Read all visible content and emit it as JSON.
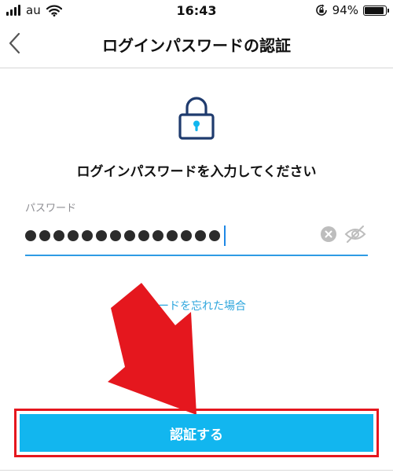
{
  "status_bar": {
    "carrier": "au",
    "time": "16:43",
    "battery_percent": "94%",
    "battery_level": 0.94
  },
  "nav": {
    "title": "ログインパスワードの認証"
  },
  "content": {
    "prompt": "ログインパスワードを入力してください",
    "password_label": "パスワード",
    "password_masked_length": 14,
    "forgot_link": "ワードを忘れた場合"
  },
  "auth_button": {
    "label": "認証する"
  },
  "icons": {
    "back": "chevron-left-icon",
    "lock": "lock-icon",
    "clear": "clear-icon",
    "visibility": "eye-off-icon",
    "signal": "signal-icon",
    "wifi": "wifi-icon",
    "rotation_lock": "rotation-lock-icon",
    "battery": "battery-icon"
  },
  "colors": {
    "accent": "#12b6ef",
    "link": "#2ea6dd",
    "icon_navy": "#1f3b6e",
    "highlight_red": "#e5171e",
    "input_underline": "#2f9be4"
  }
}
